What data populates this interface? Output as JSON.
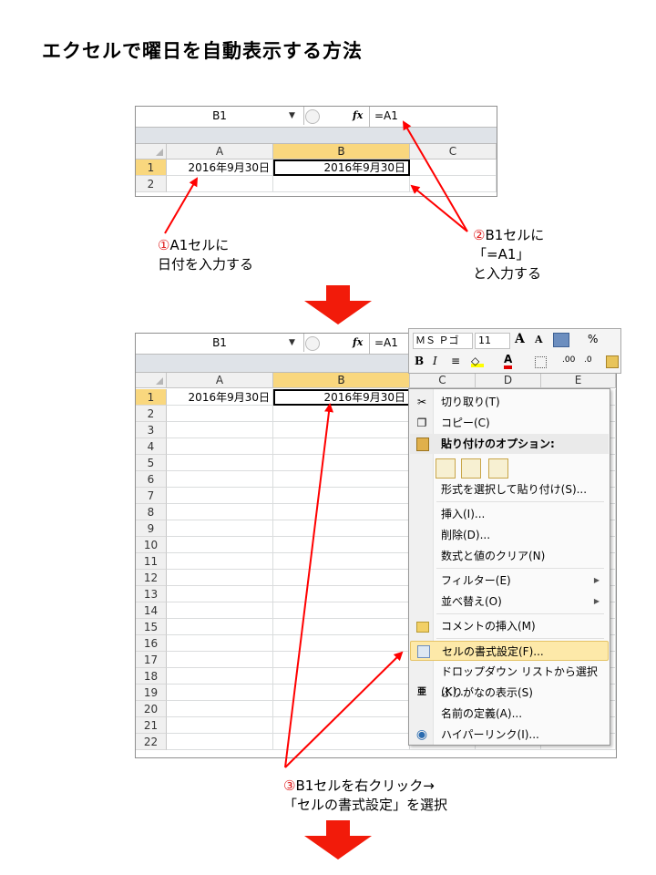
{
  "title": "エクセルで曜日を自動表示する方法",
  "excel1": {
    "name_box": "B1",
    "fx_label": "fx",
    "formula": "=A1",
    "columns": [
      "A",
      "B",
      "C"
    ],
    "rows": [
      "1",
      "2"
    ],
    "cells": {
      "A1": "2016年9月30日",
      "B1": "2016年9月30日"
    }
  },
  "note1": {
    "num": "①",
    "line1": "A1セルに",
    "line2": "日付を入力する"
  },
  "note2": {
    "num": "②",
    "line1": "B1セルに",
    "line2": "「=A1」",
    "line3": "と入力する"
  },
  "excel2": {
    "name_box": "B1",
    "fx_label": "fx",
    "formula": "=A1",
    "columns": [
      "A",
      "B",
      "C",
      "D",
      "E"
    ],
    "rows": [
      "1",
      "2",
      "3",
      "4",
      "5",
      "6",
      "7",
      "8",
      "9",
      "10",
      "11",
      "12",
      "13",
      "14",
      "15",
      "16",
      "17",
      "18",
      "19",
      "20",
      "21",
      "22"
    ],
    "cells": {
      "A1": "2016年9月30日",
      "B1": "2016年9月30日"
    }
  },
  "mini_toolbar": {
    "font": "ＭＳ Ｐゴ",
    "size": "11",
    "grow": "A",
    "shrink": "A",
    "percent": "%",
    "bold": "B",
    "italic": "I",
    "font_color": "A",
    "inc_decimal": ".00",
    "dec_decimal": ".0"
  },
  "context_menu": {
    "items": [
      {
        "label": "切り取り(T)",
        "icon": "scissors-icon"
      },
      {
        "label": "コピー(C)",
        "icon": "copy-icon"
      },
      {
        "label": "貼り付けのオプション:",
        "icon": "paste-icon"
      },
      {
        "label": "形式を選択して貼り付け(S)..."
      },
      {
        "label": "挿入(I)..."
      },
      {
        "label": "削除(D)..."
      },
      {
        "label": "数式と値のクリア(N)"
      },
      {
        "label": "フィルター(E)",
        "submenu": true
      },
      {
        "label": "並べ替え(O)",
        "submenu": true
      },
      {
        "label": "コメントの挿入(M)",
        "icon": "comment-icon"
      },
      {
        "label": "セルの書式設定(F)...",
        "icon": "format-cells-icon"
      },
      {
        "label": "ドロップダウン リストから選択(K)..."
      },
      {
        "label": "ふりがなの表示(S)",
        "icon": "furigana-icon"
      },
      {
        "label": "名前の定義(A)..."
      },
      {
        "label": "ハイパーリンク(I)...",
        "icon": "hyperlink-icon"
      }
    ]
  },
  "note3": {
    "num": "③",
    "line1": "B1セルを右クリック→",
    "line2": "「セルの書式設定」を選択"
  },
  "colors": {
    "arrow": "#ff0000",
    "down_arrow": "#f21b0a",
    "selected_header": "#f9d77e",
    "highlight": "#fde9a9"
  }
}
